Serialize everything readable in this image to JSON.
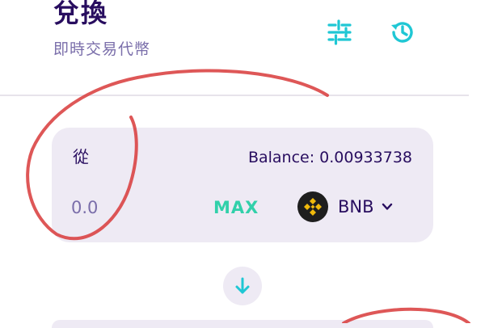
{
  "header": {
    "title": "兌換",
    "subtitle": "即時交易代幣",
    "settings_icon": "sliders-icon",
    "history_icon": "history-icon"
  },
  "from_panel": {
    "label": "從",
    "balance": "Balance: 0.00933738",
    "amount_placeholder": "0.0",
    "max_label": "MAX",
    "token": {
      "symbol": "BNB",
      "icon": "bnb-logo-icon"
    }
  },
  "swap_direction_icon": "arrow-down-icon",
  "colors": {
    "title": "#280d5f",
    "subtitle": "#7a6eaa",
    "accent": "#31d0aa",
    "panel_bg": "#eeeaf4",
    "bnb_yellow": "#f0b90b",
    "annotation_red": "#d83a3a"
  }
}
